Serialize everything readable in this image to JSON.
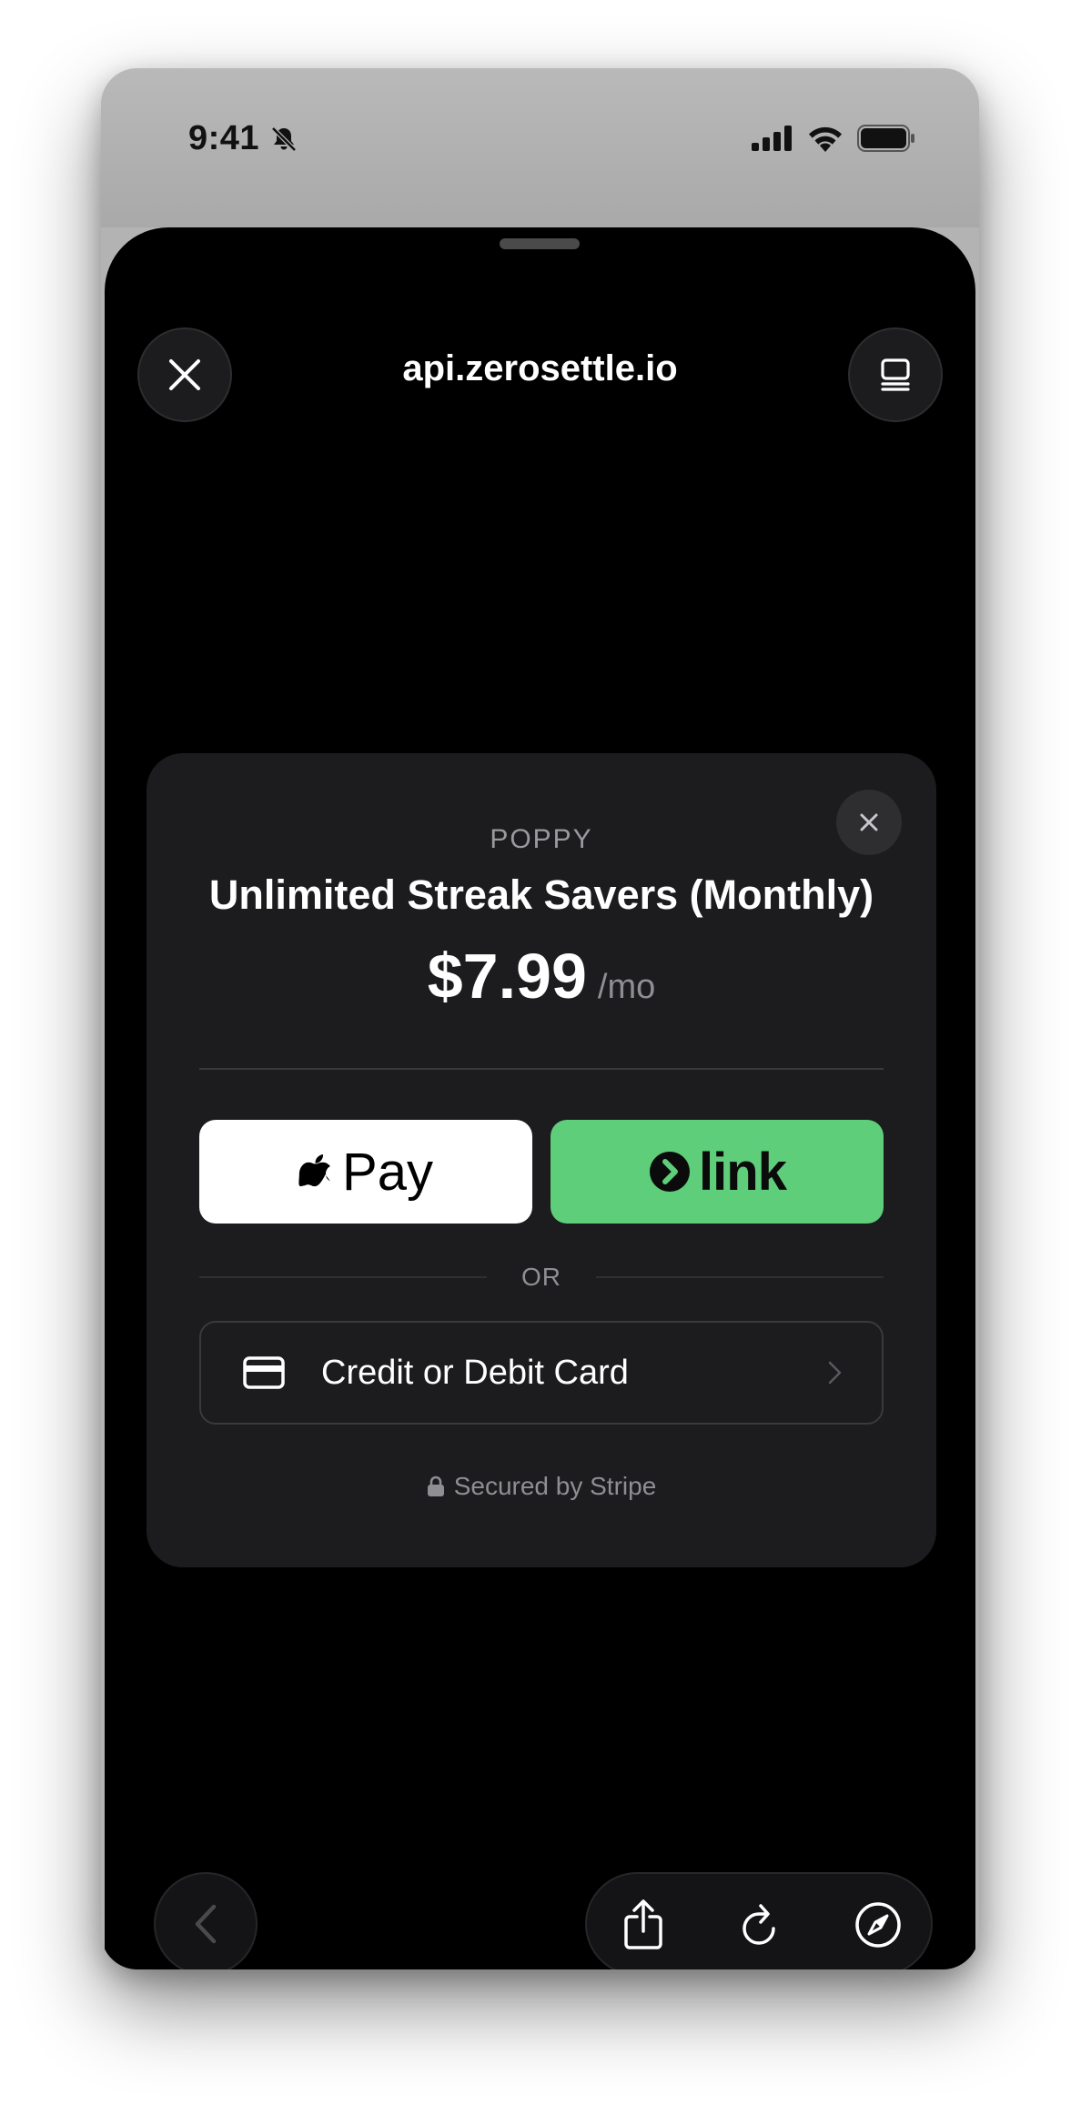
{
  "status_bar": {
    "time": "9:41"
  },
  "browser": {
    "url": "api.zerosettle.io"
  },
  "checkout": {
    "merchant": "POPPY",
    "product_name": "Unlimited Streak Savers (Monthly)",
    "price": "$7.99",
    "period": "/mo",
    "apple_pay_label": "Pay",
    "link_label": "link",
    "divider_text": "OR",
    "card_option_label": "Credit or Debit Card",
    "secured_text": "Secured by Stripe"
  },
  "colors": {
    "link_green": "#5ece7b",
    "card_bg": "#1c1c1e",
    "secondary_text": "#8e8e93"
  }
}
